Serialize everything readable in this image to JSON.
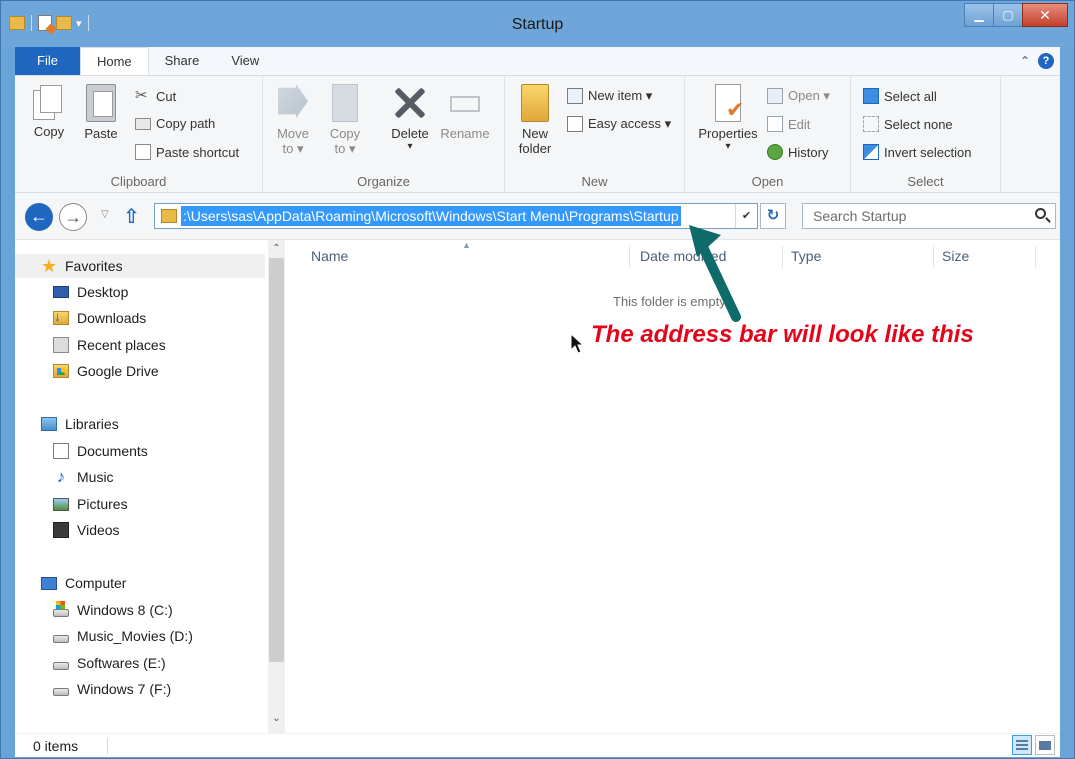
{
  "window": {
    "title": "Startup"
  },
  "tabs": [
    {
      "label": "File"
    },
    {
      "label": "Home"
    },
    {
      "label": "Share"
    },
    {
      "label": "View"
    }
  ],
  "ribbon": {
    "clipboard": {
      "label": "Clipboard",
      "copy": "Copy",
      "paste": "Paste",
      "cut": "Cut",
      "copy_path": "Copy path",
      "paste_shortcut": "Paste shortcut"
    },
    "organize": {
      "label": "Organize",
      "move_to_1": "Move",
      "move_to_2": "to ▾",
      "copy_to_1": "Copy",
      "copy_to_2": "to ▾",
      "delete": "Delete",
      "delete_caret": "▾",
      "rename": "Rename"
    },
    "new": {
      "label": "New",
      "new_folder_1": "New",
      "new_folder_2": "folder",
      "new_item": "New item ▾",
      "easy_access": "Easy access ▾"
    },
    "open": {
      "label": "Open",
      "properties": "Properties",
      "properties_caret": "▾",
      "open": "Open ▾",
      "edit": "Edit",
      "history": "History"
    },
    "select": {
      "label": "Select",
      "select_all": "Select all",
      "select_none": "Select none",
      "invert_selection": "Invert selection"
    }
  },
  "address": {
    "path": ":\\Users\\sas\\AppData\\Roaming\\Microsoft\\Windows\\Start Menu\\Programs\\Startup"
  },
  "search": {
    "placeholder": "Search Startup"
  },
  "nav_pane": {
    "favorites": {
      "label": "Favorites",
      "items": [
        "Desktop",
        "Downloads",
        "Recent places",
        "Google Drive"
      ]
    },
    "libraries": {
      "label": "Libraries",
      "items": [
        "Documents",
        "Music",
        "Pictures",
        "Videos"
      ]
    },
    "computer": {
      "label": "Computer",
      "items": [
        "Windows 8 (C:)",
        "Music_Movies (D:)",
        "Softwares (E:)",
        "Windows 7 (F:)"
      ]
    }
  },
  "columns": [
    "Name",
    "Date modified",
    "Type",
    "Size"
  ],
  "empty_message": "This folder is empty.",
  "annotation": "The address bar will look like this",
  "status": {
    "items": "0 items"
  },
  "colors": {
    "accent": "#1f66c1",
    "title_bar": "#6ea6da",
    "annotation": "#e3051b",
    "arrow": "#0f6a6a",
    "selection": "#3399ff"
  }
}
